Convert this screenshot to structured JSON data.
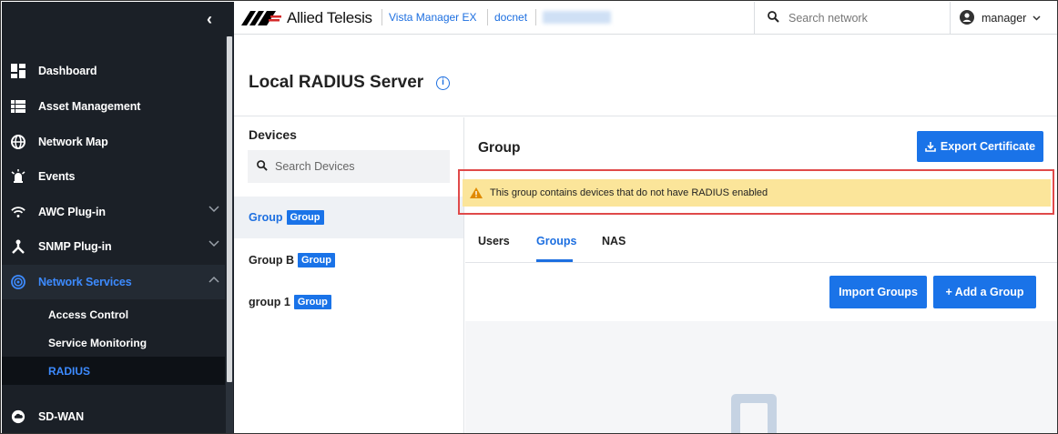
{
  "sidebar": {
    "collapse_glyph": "‹",
    "items": [
      {
        "label": "Dashboard",
        "icon": "dashboard-icon"
      },
      {
        "label": "Asset Management",
        "icon": "list-icon"
      },
      {
        "label": "Network Map",
        "icon": "globe-icon"
      },
      {
        "label": "Events",
        "icon": "alarm-icon"
      },
      {
        "label": "AWC Plug-in",
        "icon": "wifi-icon"
      },
      {
        "label": "SNMP Plug-in",
        "icon": "network-icon"
      },
      {
        "label": "Network Services",
        "icon": "radar-icon"
      },
      {
        "label": "SD-WAN",
        "icon": "cloud-icon"
      }
    ],
    "subitems": [
      "Access Control",
      "Service Monitoring",
      "RADIUS"
    ]
  },
  "header": {
    "brand": "Allied Telesis",
    "product": "Vista Manager EX",
    "site": "docnet",
    "search_placeholder": "Search network",
    "user": "manager"
  },
  "page": {
    "title": "Local RADIUS Server",
    "info_glyph": "i"
  },
  "devices": {
    "title": "Devices",
    "search_placeholder": "Search Devices",
    "rows": [
      {
        "name": "Group",
        "badge": "Group"
      },
      {
        "name": "Group B",
        "badge": "Group"
      },
      {
        "name": "group 1",
        "badge": "Group"
      }
    ]
  },
  "group": {
    "title": "Group",
    "export_label": "Export Certificate",
    "warning": "This group contains devices that do not have RADIUS enabled",
    "tabs": [
      "Users",
      "Groups",
      "NAS"
    ],
    "import_label": "Import Groups",
    "add_label": "+ Add a Group"
  },
  "colors": {
    "sidebar_bg": "#1b2027",
    "accent": "#1a73e8",
    "warning_bg": "#fbe59a",
    "highlight_border": "#e04a4a"
  }
}
